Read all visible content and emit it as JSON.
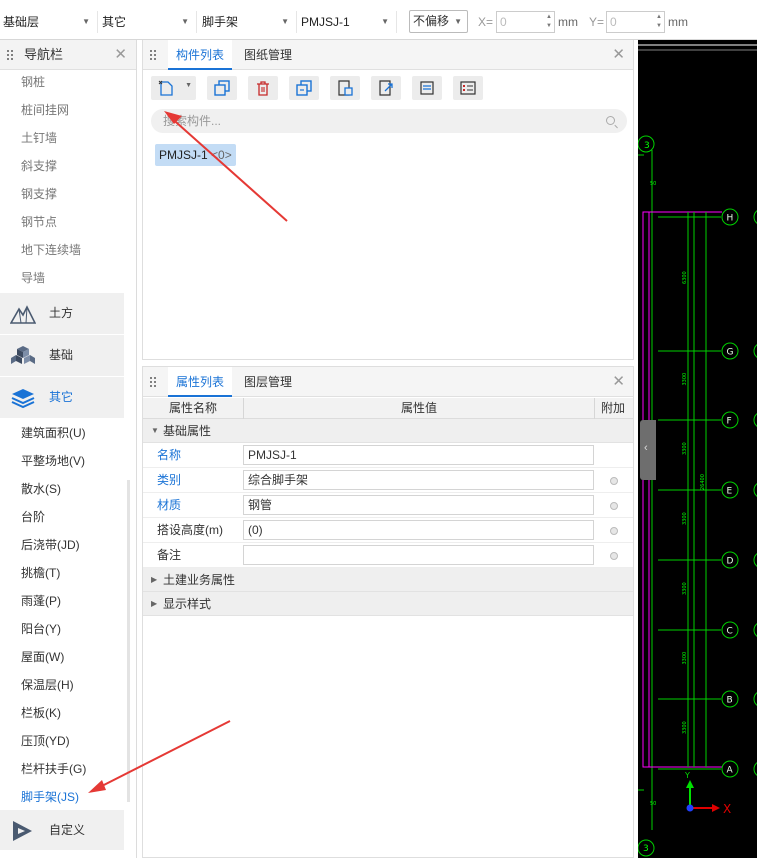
{
  "toolbar": {
    "floor_select": "基础层",
    "category_select": "其它",
    "type_select": "脚手架",
    "component_select": "PMJSJ-1",
    "offset_select": "不偏移",
    "x_label": "X=",
    "x_value": "0",
    "x_unit": "mm",
    "y_label": "Y=",
    "y_value": "0",
    "y_unit": "mm"
  },
  "nav": {
    "title": "导航栏",
    "upper_items": [
      "钢桩",
      "桩间挂网",
      "土钉墙",
      "斜支撑",
      "钢支撑",
      "钢节点",
      "地下连续墙",
      "导墙"
    ],
    "categories": [
      {
        "label": "土方",
        "icon": "earthwork-icon"
      },
      {
        "label": "基础",
        "icon": "foundation-icon"
      },
      {
        "label": "其它",
        "icon": "layers-icon"
      }
    ],
    "other_items": [
      "建筑面积(U)",
      "平整场地(V)",
      "散水(S)",
      "台阶",
      "后浇带(JD)",
      "挑檐(T)",
      "雨蓬(P)",
      "阳台(Y)",
      "屋面(W)",
      "保温层(H)",
      "栏板(K)",
      "压顶(YD)",
      "栏杆扶手(G)",
      "脚手架(JS)"
    ],
    "custom_category": "自定义"
  },
  "component_panel": {
    "tab_list": "构件列表",
    "tab_drawing": "图纸管理",
    "search_placeholder": "搜索构件...",
    "item_name": "PMJSJ-1",
    "item_count": "<0>"
  },
  "property_panel": {
    "tab_props": "属性列表",
    "tab_layers": "图层管理",
    "col_name": "属性名称",
    "col_value": "属性值",
    "col_extra": "附加",
    "group_basic": "基础属性",
    "rows": [
      {
        "name": "名称",
        "value": "PMJSJ-1"
      },
      {
        "name": "类别",
        "value": "综合脚手架"
      },
      {
        "name": "材质",
        "value": "钢管"
      },
      {
        "name": "搭设高度(m)",
        "value": "(0)"
      },
      {
        "name": "备注",
        "value": ""
      }
    ],
    "group_civil": "土建业务属性",
    "group_display": "显示样式"
  },
  "cad": {
    "axis_labels": [
      "H",
      "G",
      "F",
      "E",
      "D",
      "C",
      "B",
      "A"
    ],
    "left_axis_top": "3",
    "left_axis_bottom": "3",
    "dims": [
      "6300",
      "3300",
      "3300",
      "3300",
      "3300",
      "3300",
      "3300",
      "26400"
    ],
    "small_dim_top": "50",
    "small_dim_bottom": "50",
    "axis_x_label": "X",
    "axis_y_label": "Y",
    "grid_color": "#00d000",
    "line_color": "#ff00ff"
  },
  "accent_color": "#1a73d6",
  "annotation_color": "#e53935"
}
